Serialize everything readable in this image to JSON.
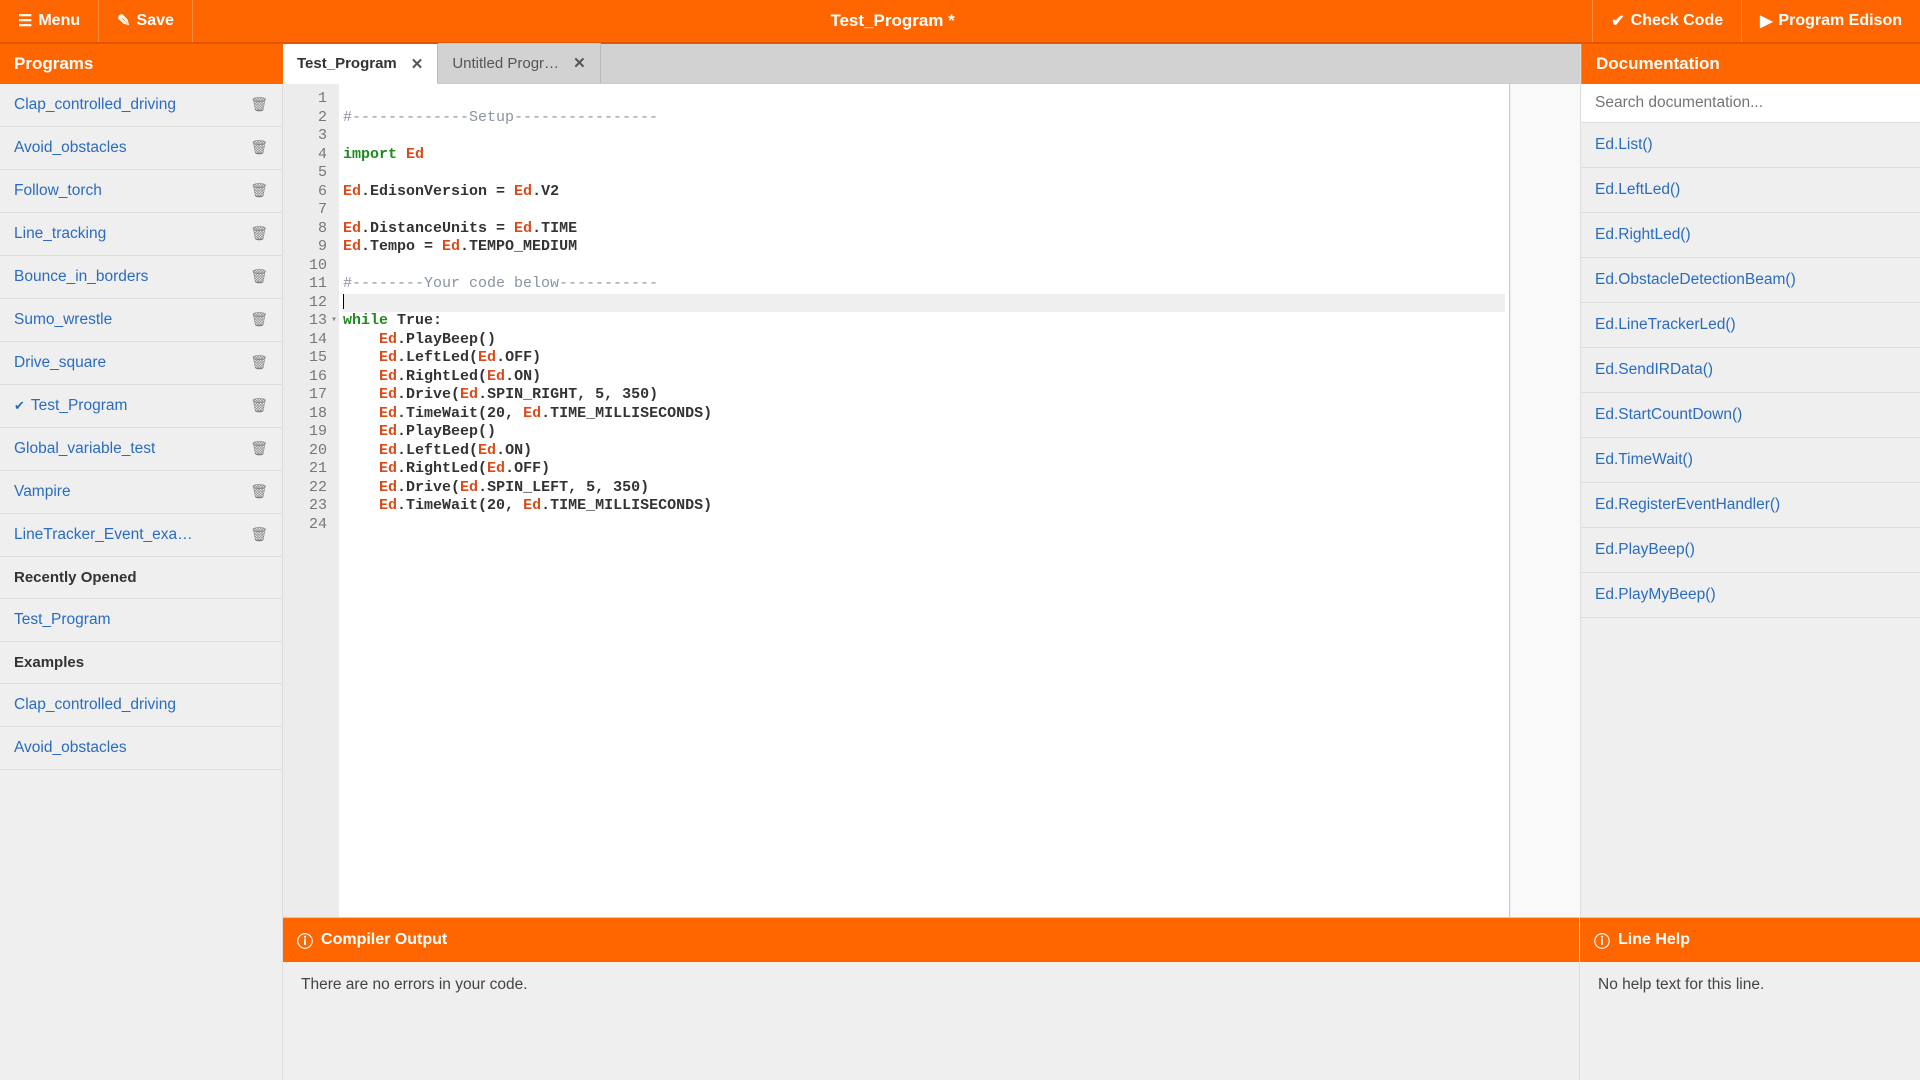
{
  "topbar": {
    "menu": "Menu",
    "save": "Save",
    "title": "Test_Program *",
    "check": "Check Code",
    "program": "Program Edison"
  },
  "sidebar": {
    "header": "Programs",
    "programs": [
      "Clap_controlled_driving",
      "Avoid_obstacles",
      "Follow_torch",
      "Line_tracking",
      "Bounce_in_borders",
      "Sumo_wrestle",
      "Drive_square",
      "Test_Program",
      "Global_variable_test",
      "Vampire",
      "LineTracker_Event_exa…"
    ],
    "active_program_index": 7,
    "recent_header": "Recently Opened",
    "recent": [
      "Test_Program"
    ],
    "examples_header": "Examples",
    "examples": [
      "Clap_controlled_driving",
      "Avoid_obstacles"
    ]
  },
  "tabs": [
    {
      "label": "Test_Program",
      "active": true
    },
    {
      "label": "Untitled Progr…",
      "active": false
    }
  ],
  "code_lines": [
    {
      "n": 1,
      "seg": []
    },
    {
      "n": 2,
      "seg": [
        [
          "c-comm",
          "#-------------Setup----------------"
        ]
      ]
    },
    {
      "n": 3,
      "seg": []
    },
    {
      "n": 4,
      "seg": [
        [
          "c-kw",
          "import "
        ],
        [
          "c-ed",
          "Ed"
        ]
      ]
    },
    {
      "n": 5,
      "seg": []
    },
    {
      "n": 6,
      "seg": [
        [
          "c-ed",
          "Ed"
        ],
        [
          "c-member",
          ".EdisonVersion = "
        ],
        [
          "c-ed",
          "Ed"
        ],
        [
          "c-member",
          ".V2"
        ]
      ]
    },
    {
      "n": 7,
      "seg": []
    },
    {
      "n": 8,
      "seg": [
        [
          "c-ed",
          "Ed"
        ],
        [
          "c-member",
          ".DistanceUnits = "
        ],
        [
          "c-ed",
          "Ed"
        ],
        [
          "c-member",
          ".TIME"
        ]
      ]
    },
    {
      "n": 9,
      "seg": [
        [
          "c-ed",
          "Ed"
        ],
        [
          "c-member",
          ".Tempo = "
        ],
        [
          "c-ed",
          "Ed"
        ],
        [
          "c-member",
          ".TEMPO_MEDIUM"
        ]
      ]
    },
    {
      "n": 10,
      "seg": []
    },
    {
      "n": 11,
      "seg": [
        [
          "c-comm",
          "#--------Your code below-----------"
        ]
      ]
    },
    {
      "n": 12,
      "seg": [],
      "current": true
    },
    {
      "n": 13,
      "seg": [
        [
          "c-kw",
          "while "
        ],
        [
          "c-member",
          "True:"
        ]
      ],
      "fold": true
    },
    {
      "n": 14,
      "seg": [
        [
          "",
          "    "
        ],
        [
          "c-ed",
          "Ed"
        ],
        [
          "c-member",
          ".PlayBeep()"
        ]
      ]
    },
    {
      "n": 15,
      "seg": [
        [
          "",
          "    "
        ],
        [
          "c-ed",
          "Ed"
        ],
        [
          "c-member",
          ".LeftLed("
        ],
        [
          "c-ed",
          "Ed"
        ],
        [
          "c-member",
          ".OFF)"
        ]
      ]
    },
    {
      "n": 16,
      "seg": [
        [
          "",
          "    "
        ],
        [
          "c-ed",
          "Ed"
        ],
        [
          "c-member",
          ".RightLed("
        ],
        [
          "c-ed",
          "Ed"
        ],
        [
          "c-member",
          ".ON)"
        ]
      ]
    },
    {
      "n": 17,
      "seg": [
        [
          "",
          "    "
        ],
        [
          "c-ed",
          "Ed"
        ],
        [
          "c-member",
          ".Drive("
        ],
        [
          "c-ed",
          "Ed"
        ],
        [
          "c-member",
          ".SPIN_RIGHT, 5, 350)"
        ]
      ]
    },
    {
      "n": 18,
      "seg": [
        [
          "",
          "    "
        ],
        [
          "c-ed",
          "Ed"
        ],
        [
          "c-member",
          ".TimeWait(20, "
        ],
        [
          "c-ed",
          "Ed"
        ],
        [
          "c-member",
          ".TIME_MILLISECONDS)"
        ]
      ]
    },
    {
      "n": 19,
      "seg": [
        [
          "",
          "    "
        ],
        [
          "c-ed",
          "Ed"
        ],
        [
          "c-member",
          ".PlayBeep()"
        ]
      ]
    },
    {
      "n": 20,
      "seg": [
        [
          "",
          "    "
        ],
        [
          "c-ed",
          "Ed"
        ],
        [
          "c-member",
          ".LeftLed("
        ],
        [
          "c-ed",
          "Ed"
        ],
        [
          "c-member",
          ".ON)"
        ]
      ]
    },
    {
      "n": 21,
      "seg": [
        [
          "",
          "    "
        ],
        [
          "c-ed",
          "Ed"
        ],
        [
          "c-member",
          ".RightLed("
        ],
        [
          "c-ed",
          "Ed"
        ],
        [
          "c-member",
          ".OFF)"
        ]
      ]
    },
    {
      "n": 22,
      "seg": [
        [
          "",
          "    "
        ],
        [
          "c-ed",
          "Ed"
        ],
        [
          "c-member",
          ".Drive("
        ],
        [
          "c-ed",
          "Ed"
        ],
        [
          "c-member",
          ".SPIN_LEFT, 5, 350)"
        ]
      ]
    },
    {
      "n": 23,
      "seg": [
        [
          "",
          "    "
        ],
        [
          "c-ed",
          "Ed"
        ],
        [
          "c-member",
          ".TimeWait(20, "
        ],
        [
          "c-ed",
          "Ed"
        ],
        [
          "c-member",
          ".TIME_MILLISECONDS)"
        ]
      ]
    },
    {
      "n": 24,
      "seg": []
    }
  ],
  "docs": {
    "header": "Documentation",
    "search_placeholder": "Search documentation...",
    "items": [
      "Ed.List()",
      "Ed.LeftLed()",
      "Ed.RightLed()",
      "Ed.ObstacleDetectionBeam()",
      "Ed.LineTrackerLed()",
      "Ed.SendIRData()",
      "Ed.StartCountDown()",
      "Ed.TimeWait()",
      "Ed.RegisterEventHandler()",
      "Ed.PlayBeep()",
      "Ed.PlayMyBeep()"
    ]
  },
  "compiler": {
    "header": "Compiler Output",
    "body": "There are no errors in your code."
  },
  "linehelp": {
    "header": "Line Help",
    "body": "No help text for this line."
  }
}
